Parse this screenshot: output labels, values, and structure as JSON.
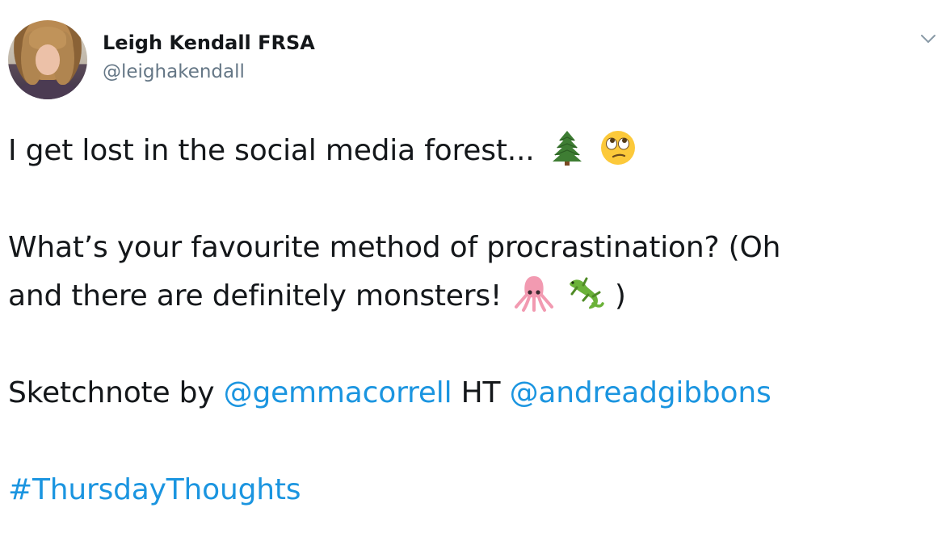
{
  "author": {
    "display_name": "Leigh Kendall FRSA",
    "handle": "@leighakendall"
  },
  "tweet": {
    "line1_text": "I get lost in the social media forest...",
    "line1_emojis": [
      "evergreen-tree-icon",
      "face-with-rolling-eyes-icon"
    ],
    "line2_text": "What’s your favourite method of procrastination? (Oh",
    "line3_text": "and there are definitely monsters!",
    "line3_emojis": [
      "squid-icon",
      "lizard-icon"
    ],
    "line3_close": ")",
    "sketchnote_prefix": "Sketchnote by",
    "mention1": "@gemmacorrell",
    "ht_text": "HT",
    "mention2": "@andreadgibbons",
    "hashtag": "#ThursdayThoughts"
  },
  "colors": {
    "text": "#14171a",
    "secondary": "#657786",
    "link": "#1b95e0"
  },
  "icons": {
    "menu": "chevron-down-icon"
  }
}
